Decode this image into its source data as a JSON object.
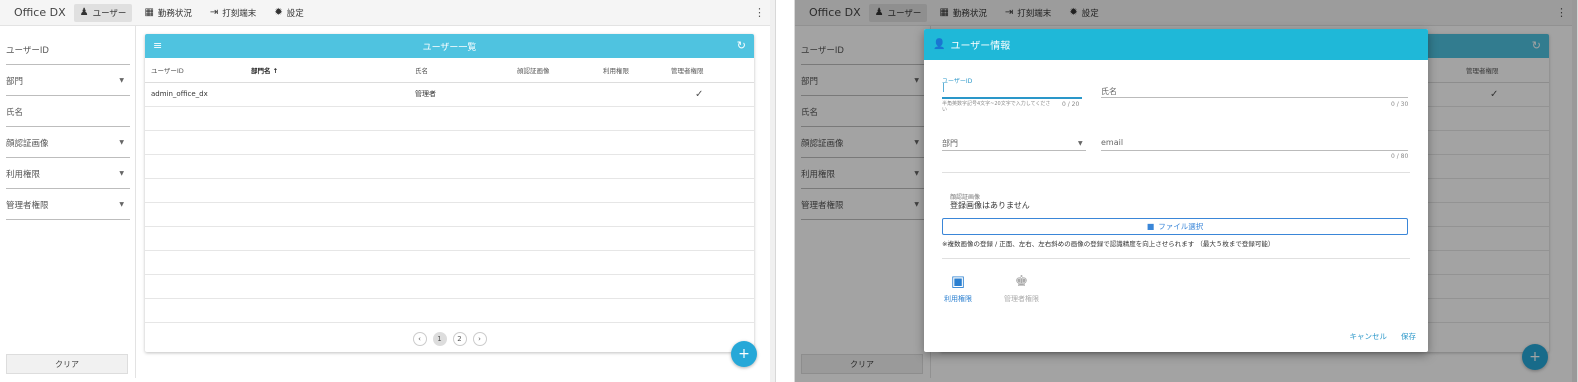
{
  "app": {
    "brand": "Office DX",
    "nav": [
      {
        "label": "ユーザー",
        "icon": "users-icon"
      },
      {
        "label": "勤務状況",
        "icon": "calendar-icon"
      },
      {
        "label": "打刻端末",
        "icon": "login-icon"
      },
      {
        "label": "設定",
        "icon": "gear-icon"
      }
    ]
  },
  "sidebar": {
    "filters": [
      {
        "label": "ユーザーID",
        "dropdown": false
      },
      {
        "label": "部門",
        "dropdown": true
      },
      {
        "label": "氏名",
        "dropdown": false
      },
      {
        "label": "顔認証画像",
        "dropdown": true
      },
      {
        "label": "利用権限",
        "dropdown": true
      },
      {
        "label": "管理者権限",
        "dropdown": true
      }
    ],
    "clear_label": "クリア"
  },
  "list": {
    "title": "ユーザー一覧",
    "columns": [
      "ユーザーID",
      "部門名 ↑",
      "氏名",
      "顔認証画像",
      "利用権限",
      "管理者権限"
    ],
    "rows": [
      {
        "user_id": "admin_office_dx",
        "dept": "",
        "name": "管理者",
        "face": "",
        "use": "",
        "admin": "✓"
      }
    ],
    "pagination": [
      "‹",
      "1",
      "2",
      "›"
    ]
  },
  "dialog": {
    "title": "ユーザー情報",
    "user_id_label": "ユーザーID",
    "user_id_hint": "半角英数字記号4文字~20文字で入力してください",
    "user_id_count": "0 / 20",
    "name_label": "氏名",
    "name_count": "0 / 30",
    "dept_label": "部門",
    "email_label": "email",
    "email_count": "0 / 80",
    "face_label": "顔認証画像",
    "face_value": "登録画像はありません",
    "file_button": "ファイル選択",
    "note": "※複数画像の登録 / 正面、左右、左右斜めの画像の登録で認識精度を向上させられます （最大５枚まで登録可能）",
    "perm_use": "利用権限",
    "perm_admin": "管理者権限",
    "cancel": "キャンセル",
    "save": "保存"
  },
  "colors": {
    "header": "#4fc3e0",
    "dialog_header": "#1fb8d8",
    "fab": "#26a8d8",
    "link": "#2a97c9"
  }
}
